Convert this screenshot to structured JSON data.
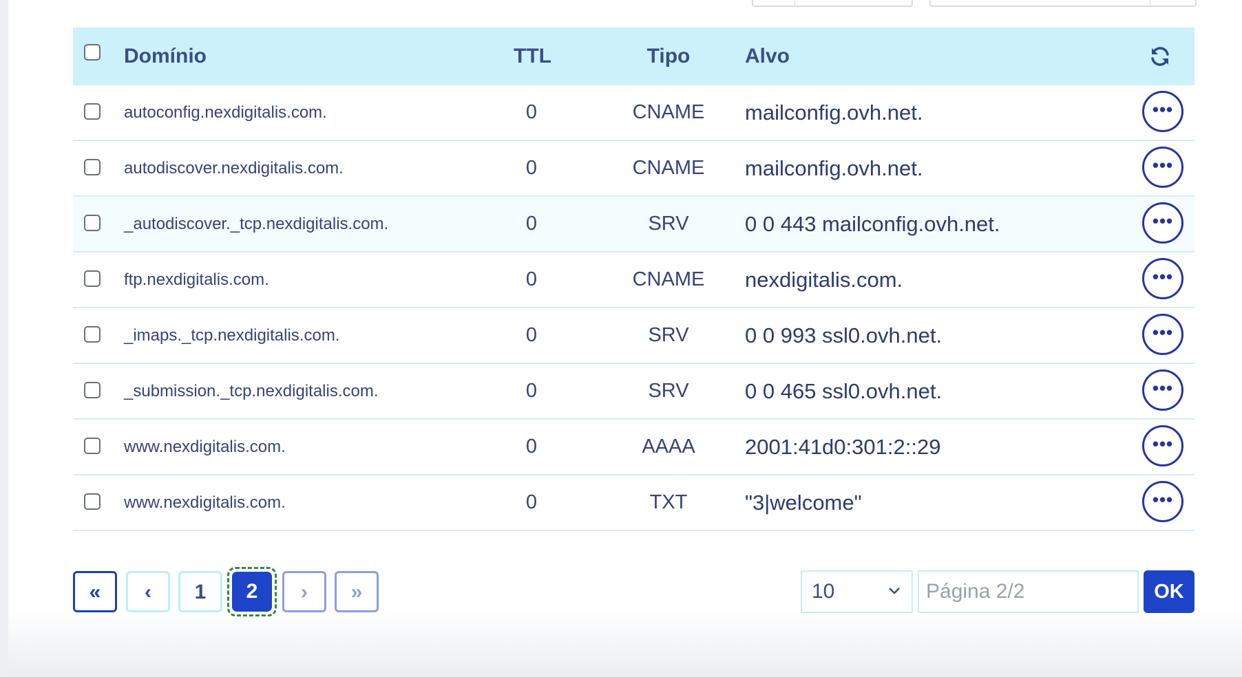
{
  "table": {
    "headers": {
      "domain": "Domínio",
      "ttl": "TTL",
      "type": "Tipo",
      "target": "Alvo"
    },
    "rows": [
      {
        "domain": "autoconfig.nexdigitalis.com.",
        "ttl": "0",
        "type": "CNAME",
        "target": "mailconfig.ovh.net."
      },
      {
        "domain": "autodiscover.nexdigitalis.com.",
        "ttl": "0",
        "type": "CNAME",
        "target": "mailconfig.ovh.net."
      },
      {
        "domain": "_autodiscover._tcp.nexdigitalis.com.",
        "ttl": "0",
        "type": "SRV",
        "target": "0 0 443 mailconfig.ovh.net."
      },
      {
        "domain": "ftp.nexdigitalis.com.",
        "ttl": "0",
        "type": "CNAME",
        "target": "nexdigitalis.com."
      },
      {
        "domain": "_imaps._tcp.nexdigitalis.com.",
        "ttl": "0",
        "type": "SRV",
        "target": "0 0 993 ssl0.ovh.net."
      },
      {
        "domain": "_submission._tcp.nexdigitalis.com.",
        "ttl": "0",
        "type": "SRV",
        "target": "0 0 465 ssl0.ovh.net."
      },
      {
        "domain": "www.nexdigitalis.com.",
        "ttl": "0",
        "type": "AAAA",
        "target": "2001:41d0:301:2::29"
      },
      {
        "domain": "www.nexdigitalis.com.",
        "ttl": "0",
        "type": "TXT",
        "target": "\"3|welcome\""
      }
    ],
    "row_action_label": "•••",
    "refresh_icon": "refresh-icon"
  },
  "pagination": {
    "first_label": "«",
    "prev_label": "‹",
    "pages": [
      "1",
      "2"
    ],
    "current_page": "2",
    "next_label": "›",
    "last_label": "»",
    "page_size": "10",
    "page_input_placeholder": "Página 2/2",
    "ok_label": "OK"
  },
  "colors": {
    "header_bg": "#ccf1fb",
    "accent": "#1e44c9",
    "action_border": "#2435a4",
    "focus_outline": "#2f8a39"
  }
}
